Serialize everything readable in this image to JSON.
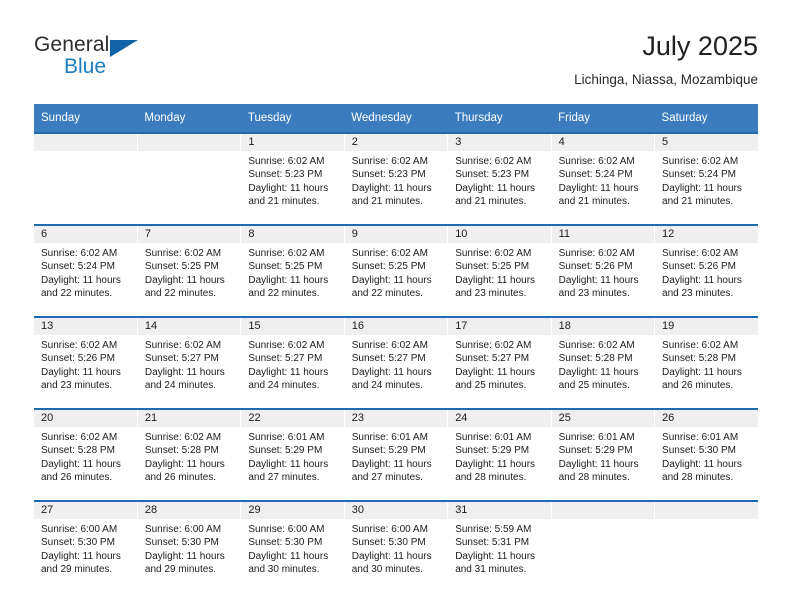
{
  "brand": {
    "name_part1": "General",
    "name_part2": "Blue",
    "logo_icon": "triangle-logo-icon"
  },
  "header": {
    "title": "July 2025",
    "location": "Lichinga, Niassa, Mozambique"
  },
  "colors": {
    "header_blue": "#3a7cbe",
    "row_border_blue": "#1f6bb0",
    "daynum_band": "#efefef",
    "brand_blue": "#1d7dc4",
    "logo_blue": "#1162a6"
  },
  "weekdays": [
    "Sunday",
    "Monday",
    "Tuesday",
    "Wednesday",
    "Thursday",
    "Friday",
    "Saturday"
  ],
  "weeks": [
    [
      {
        "day": "",
        "lines": []
      },
      {
        "day": "",
        "lines": []
      },
      {
        "day": "1",
        "lines": [
          "Sunrise: 6:02 AM",
          "Sunset: 5:23 PM",
          "Daylight: 11 hours",
          "and 21 minutes."
        ]
      },
      {
        "day": "2",
        "lines": [
          "Sunrise: 6:02 AM",
          "Sunset: 5:23 PM",
          "Daylight: 11 hours",
          "and 21 minutes."
        ]
      },
      {
        "day": "3",
        "lines": [
          "Sunrise: 6:02 AM",
          "Sunset: 5:23 PM",
          "Daylight: 11 hours",
          "and 21 minutes."
        ]
      },
      {
        "day": "4",
        "lines": [
          "Sunrise: 6:02 AM",
          "Sunset: 5:24 PM",
          "Daylight: 11 hours",
          "and 21 minutes."
        ]
      },
      {
        "day": "5",
        "lines": [
          "Sunrise: 6:02 AM",
          "Sunset: 5:24 PM",
          "Daylight: 11 hours",
          "and 21 minutes."
        ]
      }
    ],
    [
      {
        "day": "6",
        "lines": [
          "Sunrise: 6:02 AM",
          "Sunset: 5:24 PM",
          "Daylight: 11 hours",
          "and 22 minutes."
        ]
      },
      {
        "day": "7",
        "lines": [
          "Sunrise: 6:02 AM",
          "Sunset: 5:25 PM",
          "Daylight: 11 hours",
          "and 22 minutes."
        ]
      },
      {
        "day": "8",
        "lines": [
          "Sunrise: 6:02 AM",
          "Sunset: 5:25 PM",
          "Daylight: 11 hours",
          "and 22 minutes."
        ]
      },
      {
        "day": "9",
        "lines": [
          "Sunrise: 6:02 AM",
          "Sunset: 5:25 PM",
          "Daylight: 11 hours",
          "and 22 minutes."
        ]
      },
      {
        "day": "10",
        "lines": [
          "Sunrise: 6:02 AM",
          "Sunset: 5:25 PM",
          "Daylight: 11 hours",
          "and 23 minutes."
        ]
      },
      {
        "day": "11",
        "lines": [
          "Sunrise: 6:02 AM",
          "Sunset: 5:26 PM",
          "Daylight: 11 hours",
          "and 23 minutes."
        ]
      },
      {
        "day": "12",
        "lines": [
          "Sunrise: 6:02 AM",
          "Sunset: 5:26 PM",
          "Daylight: 11 hours",
          "and 23 minutes."
        ]
      }
    ],
    [
      {
        "day": "13",
        "lines": [
          "Sunrise: 6:02 AM",
          "Sunset: 5:26 PM",
          "Daylight: 11 hours",
          "and 23 minutes."
        ]
      },
      {
        "day": "14",
        "lines": [
          "Sunrise: 6:02 AM",
          "Sunset: 5:27 PM",
          "Daylight: 11 hours",
          "and 24 minutes."
        ]
      },
      {
        "day": "15",
        "lines": [
          "Sunrise: 6:02 AM",
          "Sunset: 5:27 PM",
          "Daylight: 11 hours",
          "and 24 minutes."
        ]
      },
      {
        "day": "16",
        "lines": [
          "Sunrise: 6:02 AM",
          "Sunset: 5:27 PM",
          "Daylight: 11 hours",
          "and 24 minutes."
        ]
      },
      {
        "day": "17",
        "lines": [
          "Sunrise: 6:02 AM",
          "Sunset: 5:27 PM",
          "Daylight: 11 hours",
          "and 25 minutes."
        ]
      },
      {
        "day": "18",
        "lines": [
          "Sunrise: 6:02 AM",
          "Sunset: 5:28 PM",
          "Daylight: 11 hours",
          "and 25 minutes."
        ]
      },
      {
        "day": "19",
        "lines": [
          "Sunrise: 6:02 AM",
          "Sunset: 5:28 PM",
          "Daylight: 11 hours",
          "and 26 minutes."
        ]
      }
    ],
    [
      {
        "day": "20",
        "lines": [
          "Sunrise: 6:02 AM",
          "Sunset: 5:28 PM",
          "Daylight: 11 hours",
          "and 26 minutes."
        ]
      },
      {
        "day": "21",
        "lines": [
          "Sunrise: 6:02 AM",
          "Sunset: 5:28 PM",
          "Daylight: 11 hours",
          "and 26 minutes."
        ]
      },
      {
        "day": "22",
        "lines": [
          "Sunrise: 6:01 AM",
          "Sunset: 5:29 PM",
          "Daylight: 11 hours",
          "and 27 minutes."
        ]
      },
      {
        "day": "23",
        "lines": [
          "Sunrise: 6:01 AM",
          "Sunset: 5:29 PM",
          "Daylight: 11 hours",
          "and 27 minutes."
        ]
      },
      {
        "day": "24",
        "lines": [
          "Sunrise: 6:01 AM",
          "Sunset: 5:29 PM",
          "Daylight: 11 hours",
          "and 28 minutes."
        ]
      },
      {
        "day": "25",
        "lines": [
          "Sunrise: 6:01 AM",
          "Sunset: 5:29 PM",
          "Daylight: 11 hours",
          "and 28 minutes."
        ]
      },
      {
        "day": "26",
        "lines": [
          "Sunrise: 6:01 AM",
          "Sunset: 5:30 PM",
          "Daylight: 11 hours",
          "and 28 minutes."
        ]
      }
    ],
    [
      {
        "day": "27",
        "lines": [
          "Sunrise: 6:00 AM",
          "Sunset: 5:30 PM",
          "Daylight: 11 hours",
          "and 29 minutes."
        ]
      },
      {
        "day": "28",
        "lines": [
          "Sunrise: 6:00 AM",
          "Sunset: 5:30 PM",
          "Daylight: 11 hours",
          "and 29 minutes."
        ]
      },
      {
        "day": "29",
        "lines": [
          "Sunrise: 6:00 AM",
          "Sunset: 5:30 PM",
          "Daylight: 11 hours",
          "and 30 minutes."
        ]
      },
      {
        "day": "30",
        "lines": [
          "Sunrise: 6:00 AM",
          "Sunset: 5:30 PM",
          "Daylight: 11 hours",
          "and 30 minutes."
        ]
      },
      {
        "day": "31",
        "lines": [
          "Sunrise: 5:59 AM",
          "Sunset: 5:31 PM",
          "Daylight: 11 hours",
          "and 31 minutes."
        ]
      },
      {
        "day": "",
        "lines": []
      },
      {
        "day": "",
        "lines": []
      }
    ]
  ]
}
